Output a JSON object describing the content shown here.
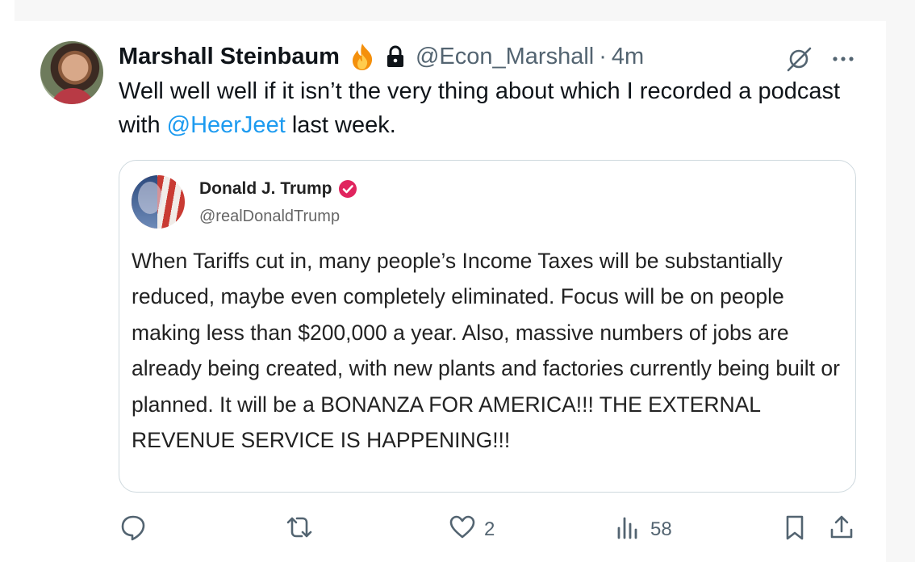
{
  "tweet": {
    "author_name": "Marshall Steinbaum",
    "author_handle": "@Econ_Marshall",
    "separator": "·",
    "time": "4m",
    "text_before": "Well well well if it isn’t the very thing about which I recorded a podcast with ",
    "mention": "@HeerJeet",
    "text_after": " last week."
  },
  "quoted": {
    "author_name": "Donald J. Trump",
    "author_handle": "@realDonaldTrump",
    "text": "When Tariffs cut in, many people’s Income Taxes will be substantially reduced, maybe even completely eliminated. Focus will be on people making less than $200,000 a year. Also, massive numbers of jobs are already being created, with new plants and factories currently being built or planned. It will be a BONANZA FOR AMERICA!!! THE EXTERNAL REVENUE SERVICE IS HAPPENING!!!"
  },
  "actions": {
    "reply_count": "",
    "retweet_count": "",
    "like_count": "2",
    "views_count": "58"
  },
  "icons": {
    "flame": "flame-emoji-icon",
    "lock": "lock-icon",
    "grok": "grok-icon",
    "more": "more-icon",
    "verified": "verified-badge-icon",
    "reply": "reply-icon",
    "retweet": "retweet-icon",
    "like": "heart-icon",
    "views": "views-icon",
    "bookmark": "bookmark-icon",
    "share": "share-icon"
  },
  "colors": {
    "text": "#0f1419",
    "secondary": "#536471",
    "link": "#1d9bf0",
    "verified": "#e0245e",
    "border": "#cfd9de"
  }
}
